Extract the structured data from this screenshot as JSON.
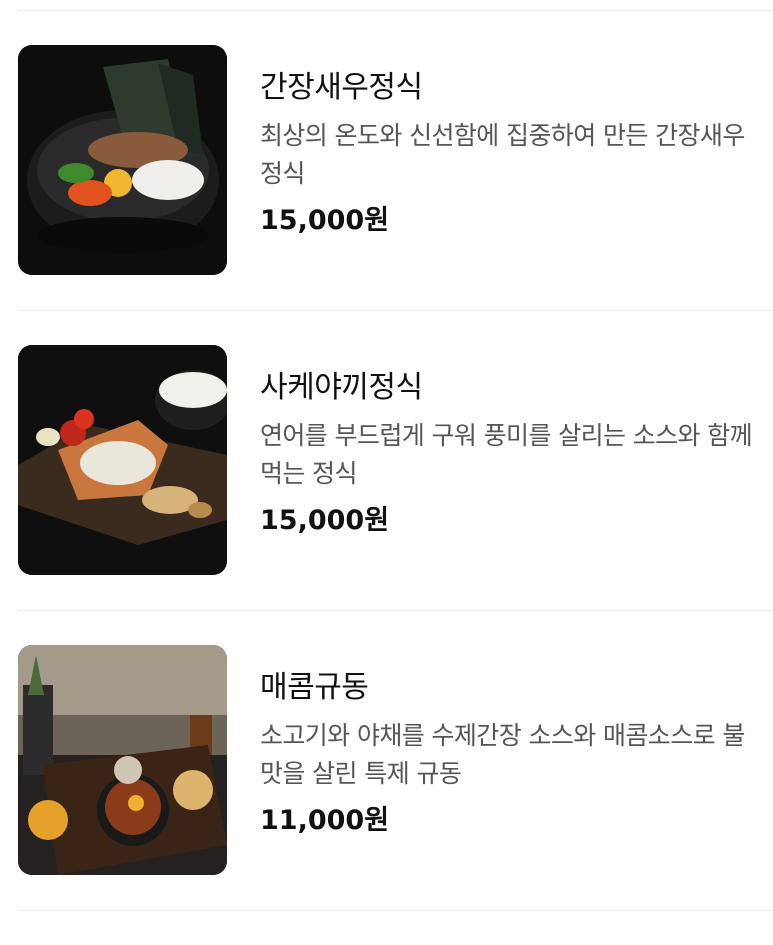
{
  "menu": {
    "items": [
      {
        "name": "간장새우정식",
        "description": "최상의 온도와 신선함에 집중하여 만든 간장새우정식",
        "price": "15,000원",
        "image_icon": "soy-shrimp-bowl-photo"
      },
      {
        "name": "사케야끼정식",
        "description": "연어를 부드럽게 구워 풍미를 살리는 소스와 함께먹는 정식",
        "price": "15,000원",
        "image_icon": "grilled-salmon-plate-photo"
      },
      {
        "name": "매콤규동",
        "description": "소고기와 야채를 수제간장 소스와 매콤소스로 불맛을 살린 특제 규동",
        "price": "11,000원",
        "image_icon": "spicy-gyudon-set-photo"
      }
    ]
  }
}
